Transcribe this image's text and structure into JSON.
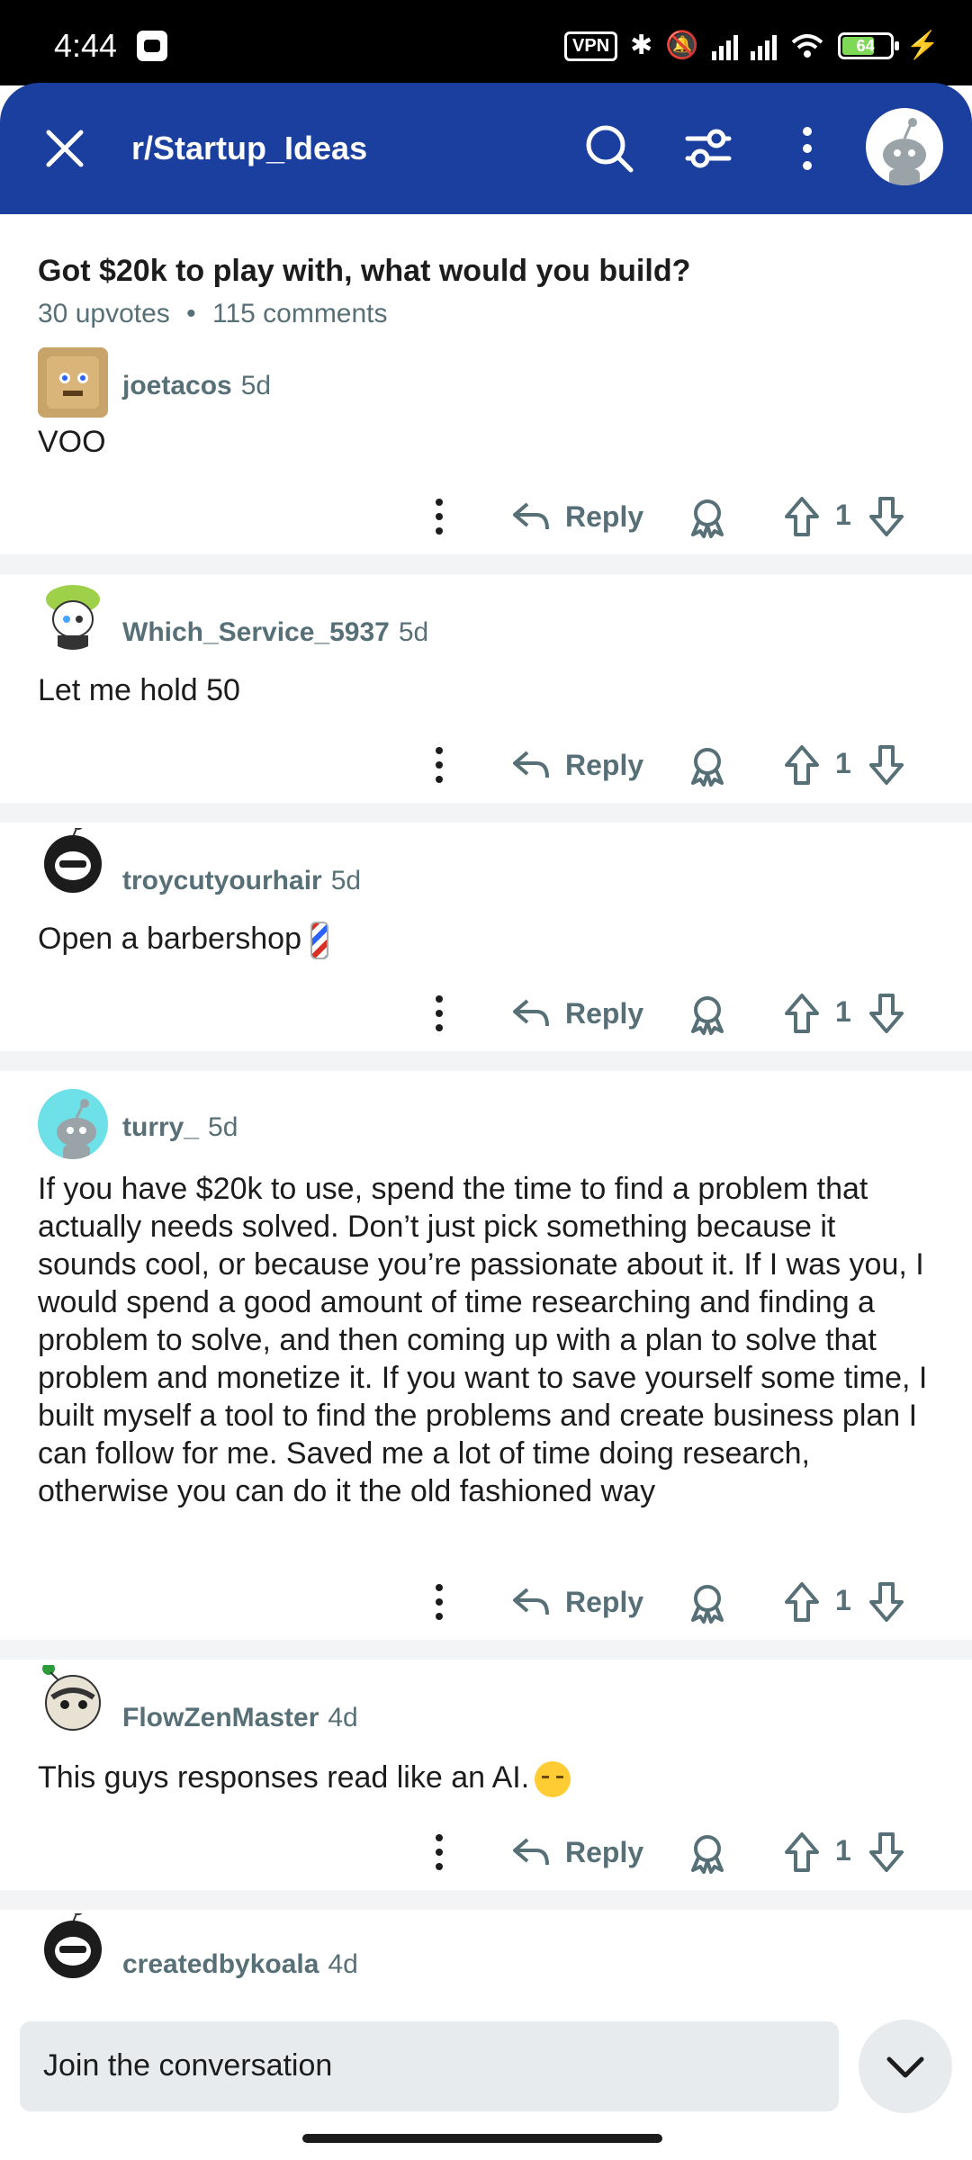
{
  "status_bar": {
    "time": "4:44",
    "vpn": "VPN",
    "battery": "64"
  },
  "header": {
    "title": "r/Startup_Ideas"
  },
  "post": {
    "title": "Got $20k to play with, what would you build?",
    "upvotes": "30 upvotes",
    "dot": "•",
    "comments": "115 comments"
  },
  "comments": [
    {
      "author": "joetacos",
      "age": "5d",
      "body": "VOO",
      "reply": "Reply",
      "score": "1"
    },
    {
      "author": "Which_Service_5937",
      "age": "5d",
      "body": "Let me hold 50",
      "reply": "Reply",
      "score": "1"
    },
    {
      "author": "troycutyourhair",
      "age": "5d",
      "body": "Open a barbershop",
      "reply": "Reply",
      "score": "1"
    },
    {
      "author": "turry_",
      "age": "5d",
      "body": "If you have $20k to use, spend the time to find a problem that actually needs solved. Don’t just pick something because it sounds cool, or because you’re passionate about it. If I was you, I would spend a good amount of time researching and finding a problem to solve, and then coming up with a plan to solve that problem and monetize it. If you want to save yourself some time, I built myself a tool to find the problems and create business plan I can follow for me. Saved me a lot of time doing research, otherwise you can do it the old fashioned way",
      "reply": "Reply",
      "score": "1"
    },
    {
      "author": "FlowZenMaster",
      "age": "4d",
      "body": "This guys responses read like an AI.",
      "reply": "Reply",
      "score": "1"
    },
    {
      "author": "createdbykoala",
      "age": "4d"
    }
  ],
  "composer": {
    "placeholder": "Join the conversation"
  },
  "colors": {
    "header_bg": "#1b3f9e",
    "meta_text": "#576f76",
    "separator": "#f2f4f5"
  }
}
